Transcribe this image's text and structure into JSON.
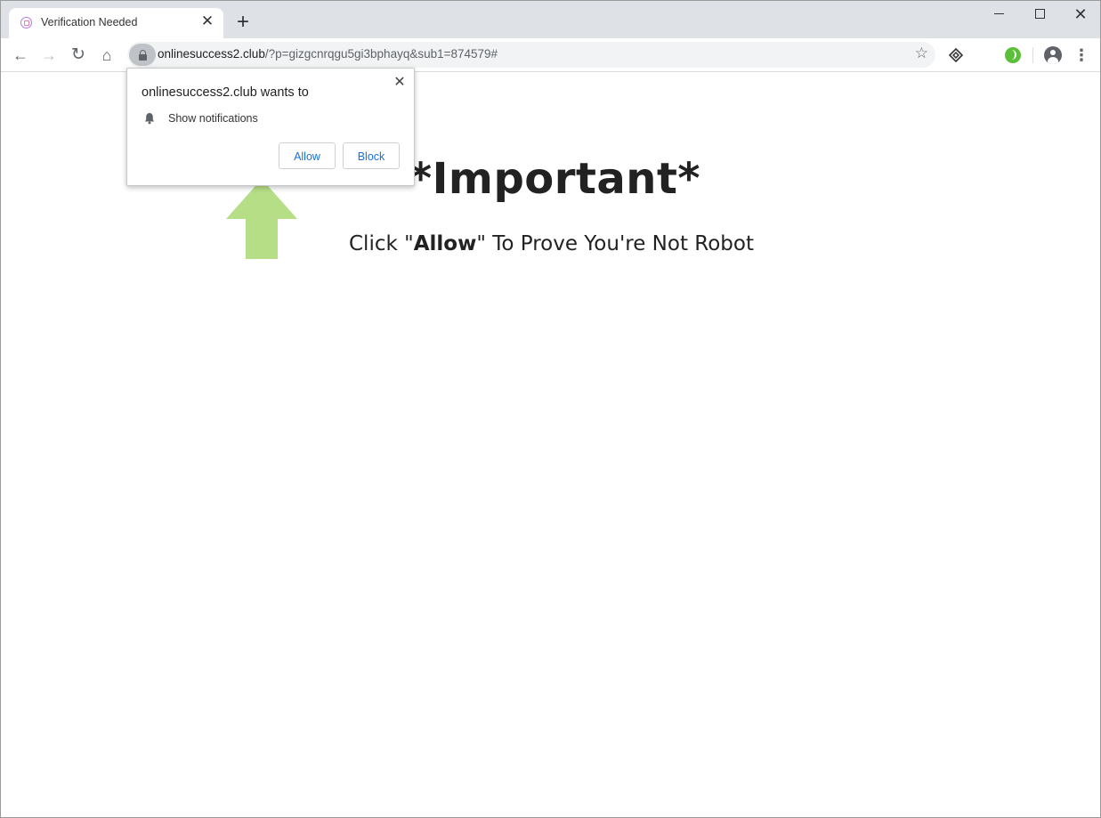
{
  "tab": {
    "title": "Verification Needed",
    "close_label": "✕",
    "new_tab_label": "+"
  },
  "window_controls": {
    "close_label": "✕"
  },
  "toolbar": {
    "back_label": "←",
    "forward_label": "→",
    "reload_label": "↻",
    "home_label": "⌂",
    "star_label": "☆",
    "menu_label": "⋮"
  },
  "address_bar": {
    "host": "onlinesuccess2.club",
    "path": "/?p=gizgcnrqgu5gi3bphayq&sub1=874579#"
  },
  "permission_prompt": {
    "title": "onlinesuccess2.club wants to",
    "permission": "Show notifications",
    "close_label": "✕",
    "allow_label": "Allow",
    "block_label": "Block"
  },
  "page": {
    "headline": "*Important*",
    "sub_before": "Click \"",
    "sub_bold": "Allow",
    "sub_after": "\" To Prove You're Not Robot"
  },
  "colors": {
    "arrow": "#b5de86",
    "button_text": "#1a6fd6",
    "tabstrip": "#dee1e6"
  }
}
